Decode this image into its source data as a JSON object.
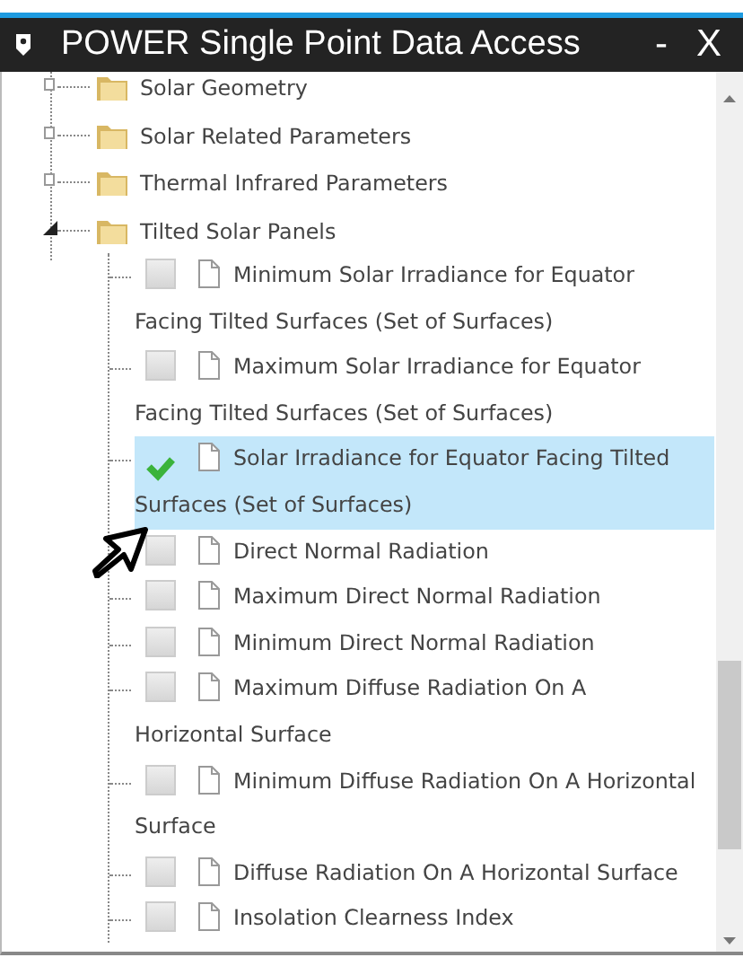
{
  "window": {
    "title": "POWER Single Point Data Access",
    "controls": [
      "-",
      "X"
    ]
  },
  "tree": [
    {
      "label": "Solar Geometry",
      "expanded": false
    },
    {
      "label": "Solar Related Parameters",
      "expanded": false
    },
    {
      "label": "Thermal Infrared Parameters",
      "expanded": false
    },
    {
      "label": "Tilted Solar Panels",
      "expanded": true,
      "children": [
        {
          "label": "Minimum Solar Irradiance for Equator Facing Tilted Surfaces (Set of Surfaces)",
          "checked": false,
          "selected": false
        },
        {
          "label": "Maximum Solar Irradiance for Equator Facing Tilted Surfaces (Set of Surfaces)",
          "checked": false,
          "selected": false
        },
        {
          "label": "Solar Irradiance for Equator Facing Tilted Surfaces (Set of Surfaces)",
          "checked": true,
          "selected": true
        },
        {
          "label": "Direct Normal Radiation",
          "checked": false,
          "selected": false
        },
        {
          "label": "Maximum Direct Normal Radiation",
          "checked": false,
          "selected": false
        },
        {
          "label": "Minimum Direct Normal Radiation",
          "checked": false,
          "selected": false
        },
        {
          "label": "Maximum Diffuse Radiation On A Horizontal Surface",
          "checked": false,
          "selected": false
        },
        {
          "label": "Minimum Diffuse Radiation On A Horizontal Surface",
          "checked": false,
          "selected": false
        },
        {
          "label": "Diffuse Radiation On A Horizontal Surface",
          "checked": false,
          "selected": false
        },
        {
          "label": "Insolation Clearness Index",
          "checked": false,
          "selected": false
        }
      ]
    }
  ]
}
